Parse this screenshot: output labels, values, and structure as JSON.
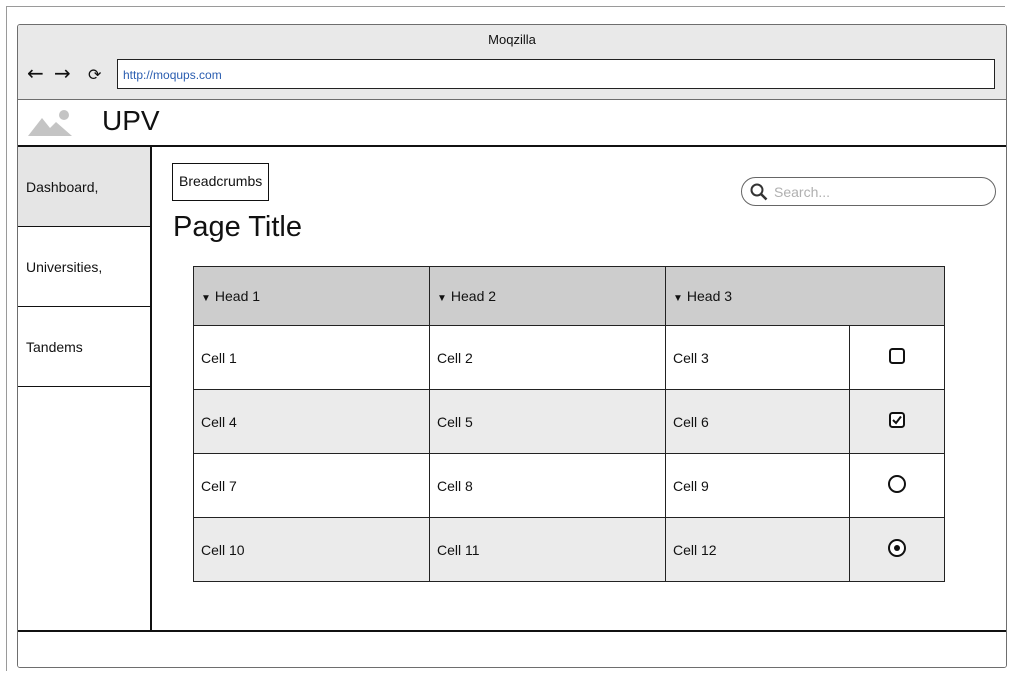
{
  "browser": {
    "window_title": "Moqzilla",
    "url": "http://moqups.com",
    "back_icon": "←",
    "forward_icon": "→",
    "reload_icon": "⟳"
  },
  "app": {
    "title": "UPV",
    "logo_icon": "image-placeholder-icon"
  },
  "sidebar": {
    "items": [
      {
        "label": "Dashboard,",
        "active": true
      },
      {
        "label": "Universities,",
        "active": false
      },
      {
        "label": "Tandems",
        "active": false
      }
    ]
  },
  "breadcrumbs": {
    "label": "Breadcrumbs"
  },
  "search": {
    "placeholder": "Search..."
  },
  "page": {
    "title": "Page Title"
  },
  "table": {
    "headers": [
      "Head 1",
      "Head 2",
      "Head 3"
    ],
    "sort_icon": "▼",
    "rows": [
      {
        "cells": [
          "Cell 1",
          "Cell 2",
          "Cell 3"
        ],
        "control": "checkbox",
        "checked": false
      },
      {
        "cells": [
          "Cell 4",
          "Cell 5",
          "Cell 6"
        ],
        "control": "checkbox",
        "checked": true
      },
      {
        "cells": [
          "Cell 7",
          "Cell 8",
          "Cell 9"
        ],
        "control": "radio",
        "checked": false
      },
      {
        "cells": [
          "Cell 10",
          "Cell 11",
          "Cell 12"
        ],
        "control": "radio",
        "checked": true
      }
    ]
  },
  "colors": {
    "chrome_bg": "#e9e9e9",
    "header_bg": "#cdcdcd",
    "alt_row_bg": "#ebebeb",
    "url_text": "#2a5db0",
    "active_nav_bg": "#e5e5e5"
  }
}
